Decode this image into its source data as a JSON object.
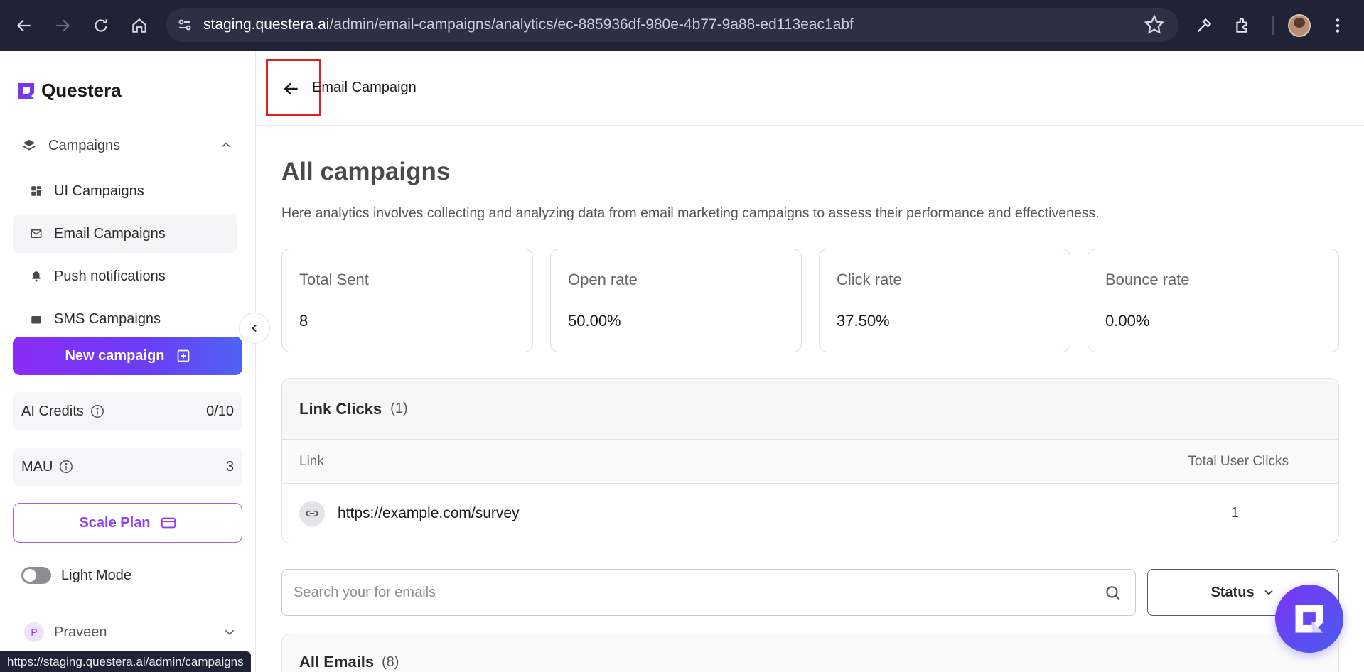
{
  "browser": {
    "url_host": "staging.questera.ai",
    "url_path": "/admin/email-campaigns/analytics/ec-885936df-980e-4b77-9a88-ed113eac1abf",
    "status_url": "https://staging.questera.ai/admin/campaigns"
  },
  "brand": {
    "name": "Questera"
  },
  "sidebar": {
    "group_label": "Campaigns",
    "items": [
      {
        "label": "UI Campaigns",
        "icon": "dashboard-icon"
      },
      {
        "label": "Email Campaigns",
        "icon": "email-icon",
        "active": true
      },
      {
        "label": "Push notifications",
        "icon": "bell-icon"
      },
      {
        "label": "SMS Campaigns",
        "icon": "sms-icon"
      }
    ],
    "new_campaign_label": "New campaign",
    "ai_credits": {
      "label": "AI Credits",
      "value": "0/10"
    },
    "mau": {
      "label": "MAU",
      "value": "3"
    },
    "scale_plan_label": "Scale Plan",
    "mode_label": "Light Mode",
    "user": {
      "initial": "P",
      "name": "Praveen"
    }
  },
  "header": {
    "crumb": "Email Campaign"
  },
  "main": {
    "title": "All campaigns",
    "description": "Here analytics involves collecting and analyzing data from email marketing campaigns to assess their performance and effectiveness.",
    "metrics": [
      {
        "label": "Total Sent",
        "value": "8"
      },
      {
        "label": "Open rate",
        "value": "50.00%"
      },
      {
        "label": "Click rate",
        "value": "37.50%"
      },
      {
        "label": "Bounce rate",
        "value": "0.00%"
      }
    ],
    "link_clicks": {
      "title": "Link Clicks",
      "count": "(1)",
      "col_link": "Link",
      "col_clicks": "Total User Clicks",
      "rows": [
        {
          "url": "https://example.com/survey",
          "clicks": "1"
        }
      ]
    },
    "search": {
      "placeholder": "Search your for emails",
      "value": ""
    },
    "status_filter": "Status",
    "all_emails": {
      "title": "All Emails",
      "count": "(8)"
    }
  },
  "colors": {
    "accent": "#8e3ff5",
    "highlight": "#e0201f"
  }
}
